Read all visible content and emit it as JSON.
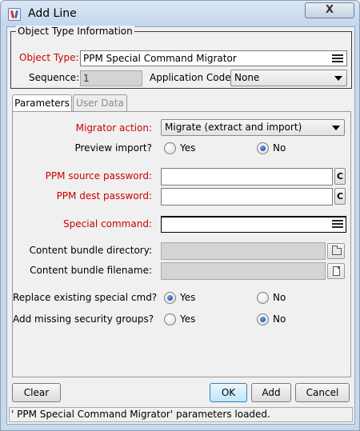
{
  "window": {
    "title": "Add Line",
    "close_label": "X"
  },
  "object_type_info": {
    "group_title": "Object Type Information",
    "object_type_label": "Object Type:",
    "object_type_value": "PPM Special Command Migrator",
    "sequence_label": "Sequence:",
    "sequence_value": "1",
    "application_code_label": "Application Code:",
    "application_code_value": "None"
  },
  "tabs": [
    {
      "label": "Parameters",
      "active": true
    },
    {
      "label": "User Data",
      "active": false
    }
  ],
  "parameters": {
    "migrator_action_label": "Migrator action:",
    "migrator_action_value": "Migrate (extract and import)",
    "preview_import_label": "Preview import?",
    "preview_yes": "Yes",
    "preview_no": "No",
    "preview_selected": "No",
    "source_password_label": "PPM source password:",
    "source_password_value": "",
    "dest_password_label": "PPM dest password:",
    "dest_password_value": "",
    "clear_glyph": "C",
    "special_command_label": "Special command:",
    "special_command_value": "",
    "bundle_dir_label": "Content bundle directory:",
    "bundle_dir_value": "",
    "bundle_file_label": "Content bundle filename:",
    "bundle_file_value": "",
    "replace_label": "Replace existing special cmd?",
    "replace_yes": "Yes",
    "replace_no": "No",
    "replace_selected": "Yes",
    "add_groups_label": "Add missing security groups?",
    "add_groups_yes": "Yes",
    "add_groups_no": "No",
    "add_groups_selected": "No"
  },
  "buttons": {
    "clear": "Clear",
    "ok": "OK",
    "add": "Add",
    "cancel": "Cancel"
  },
  "status": {
    "message": "' PPM Special Command Migrator' parameters loaded."
  },
  "colors": {
    "required_label": "#cc0000",
    "window_frame": "#c9d9ec",
    "default_button": "#bee6fd"
  }
}
